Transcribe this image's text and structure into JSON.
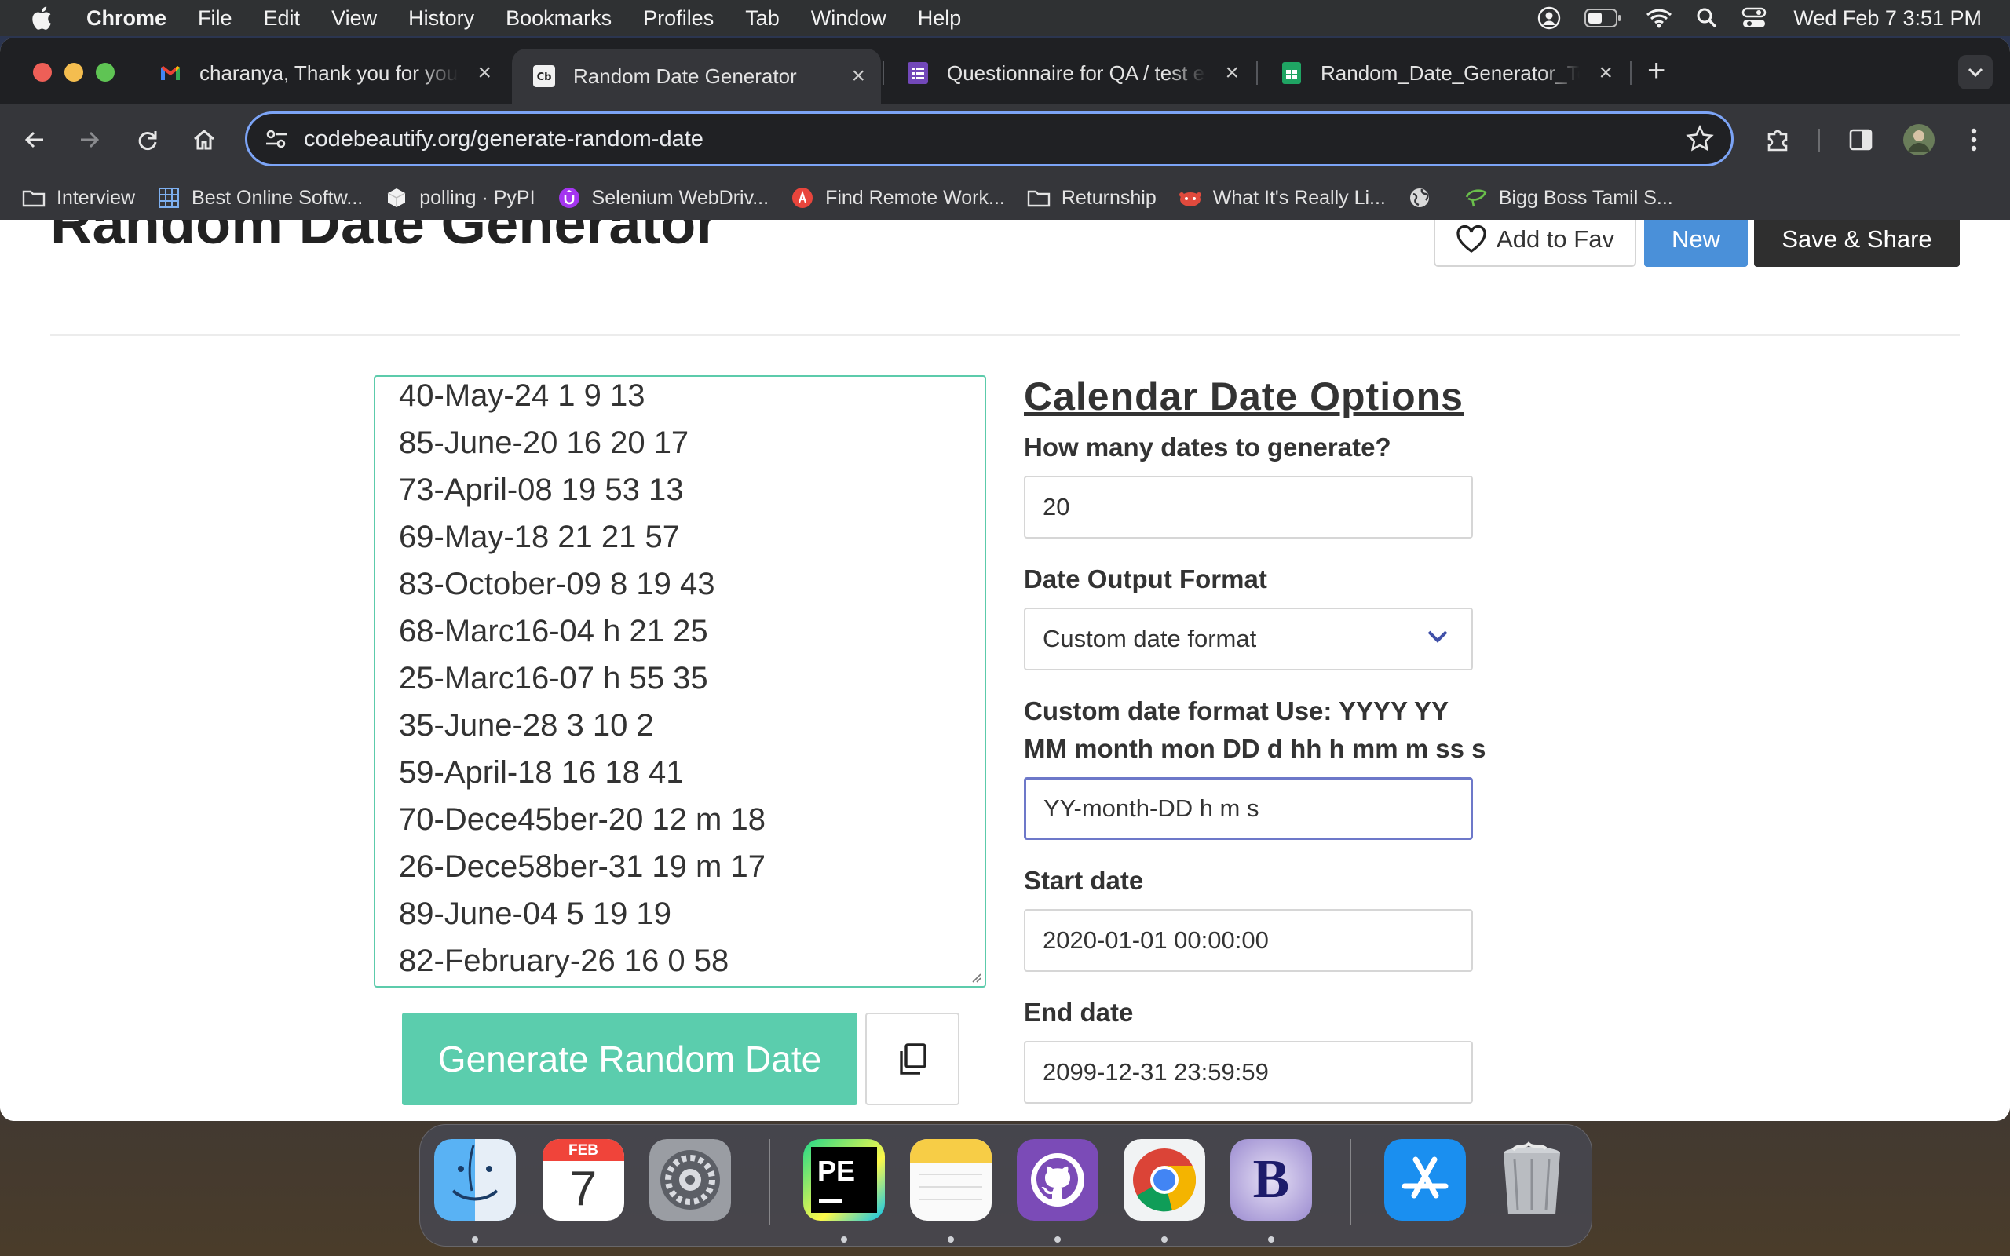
{
  "menubar": {
    "items": [
      "Chrome",
      "File",
      "Edit",
      "View",
      "History",
      "Bookmarks",
      "Profiles",
      "Tab",
      "Window",
      "Help"
    ],
    "clock": "Wed Feb 7  3:51 PM"
  },
  "tabs": [
    {
      "title": "charanya, Thank you for your",
      "icon": "gmail-icon"
    },
    {
      "title": "Random Date Generator",
      "icon": "codebeautify-icon"
    },
    {
      "title": "Questionnaire for QA / test en",
      "icon": "forms-icon"
    },
    {
      "title": "Random_Date_Generator_Te",
      "icon": "sheets-icon"
    }
  ],
  "addressbar": {
    "url": "codebeautify.org/generate-random-date"
  },
  "bookmarks": [
    {
      "label": "Interview",
      "icon": "folder-icon"
    },
    {
      "label": "Best Online Softw...",
      "icon": "grid-icon"
    },
    {
      "label": "polling · PyPI",
      "icon": "package-icon"
    },
    {
      "label": "Selenium WebDriv...",
      "icon": "udemy-icon"
    },
    {
      "label": "Find Remote Work...",
      "icon": "remote-icon"
    },
    {
      "label": "Returnship",
      "icon": "folder-icon"
    },
    {
      "label": "What It's Really Li...",
      "icon": "reddit-icon"
    },
    {
      "label": "",
      "icon": "globe-icon"
    },
    {
      "label": "Bigg Boss Tamil S...",
      "icon": "leaf-icon"
    }
  ],
  "page": {
    "title": "Random Date Generator",
    "add_fav": "Add to Fav",
    "new": "New",
    "save_share": "Save & Share",
    "output_lines": [
      "40-May-24 1 9 13",
      "85-June-20 16 20 17",
      "73-April-08 19 53 13",
      "69-May-18 21 21 57",
      "83-October-09 8 19 43",
      "68-Marc16-04 h 21 25",
      "25-Marc16-07 h 55 35",
      "35-June-28 3 10 2",
      "59-April-18 16 18 41",
      "70-Dece45ber-20 12 m 18",
      "26-Dece58ber-31 19 m 17",
      "89-June-04 5 19 19",
      "82-February-26 16 0 58"
    ],
    "generate_button": "Generate Random Date"
  },
  "options": {
    "heading": "Calendar Date Options",
    "count_label": "How many dates to generate?",
    "count_value": "20",
    "format_label": "Date Output Format",
    "format_value": "Custom date format",
    "custom_label_line1": "Custom date format Use: YYYY YY",
    "custom_label_line2": "MM month mon DD d hh h mm m ss s",
    "custom_value": "YY-month-DD h m s",
    "start_label": "Start date",
    "start_value": "2020-01-01 00:00:00",
    "end_label": "End date",
    "end_value": "2099-12-31 23:59:59"
  },
  "dock": {
    "calendar_month": "FEB",
    "calendar_day": "7",
    "pycharm_label": "PE",
    "bbedit_label": "B"
  },
  "colors": {
    "accent_teal": "#5bcdad",
    "new_blue": "#4a90d9",
    "focus_border": "#6d78c9"
  }
}
